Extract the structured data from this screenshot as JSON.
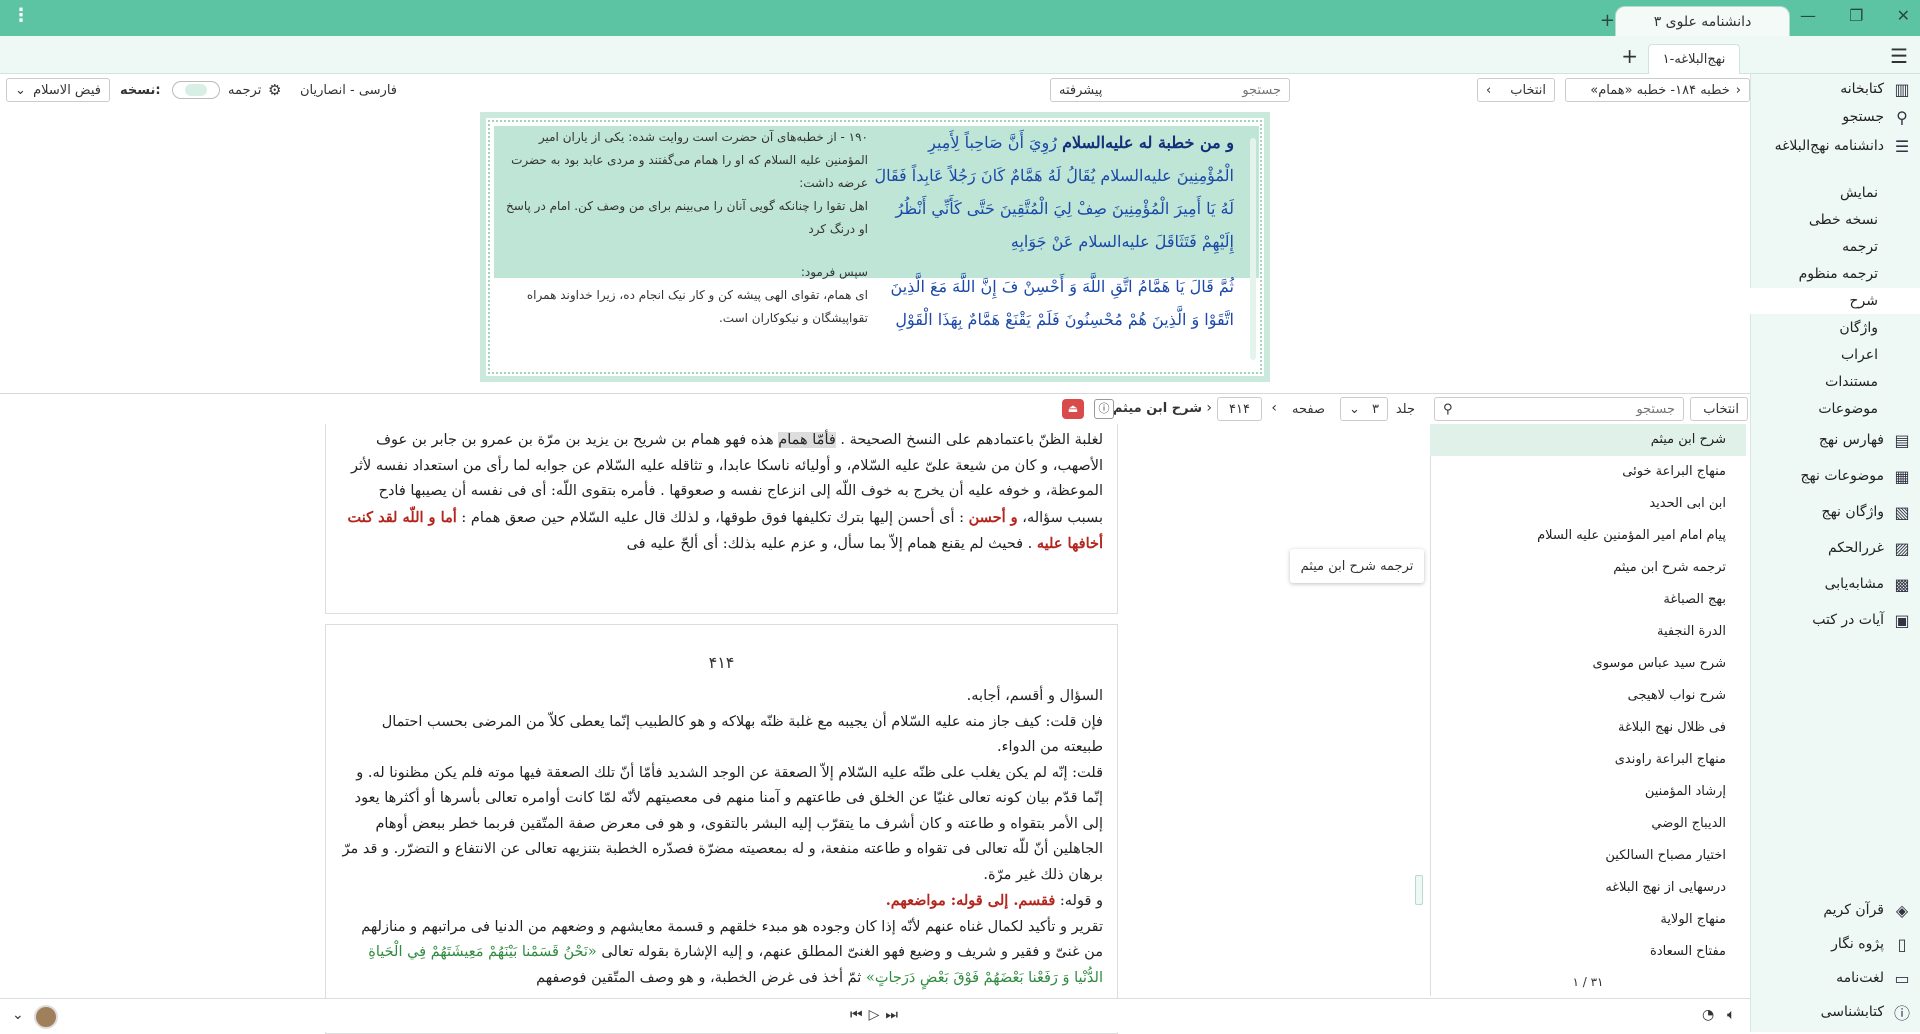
{
  "titlebar": {
    "app_tab": "دانشنامه علوی ۳",
    "menu_icon": "kebab-icon"
  },
  "tabbar": {
    "doc_tab": "نهج‌البلاغه-۱"
  },
  "sidebar": {
    "top_items": [
      {
        "label": "کتابخانه",
        "icon": "library-icon"
      },
      {
        "label": "جستجو",
        "icon": "search-icon"
      },
      {
        "label": "دانشنامه نهج‌البلاغه",
        "icon": "encyclopedia-icon"
      }
    ],
    "sub_items": [
      "نمایش",
      "نسخه خطی",
      "ترجمه",
      "ترجمه منظوم",
      "شرح",
      "واژگان",
      "اعراب",
      "مستندات",
      "موضوعات"
    ],
    "active_sub": "شرح",
    "mid_items": [
      {
        "label": "فهارس نهج",
        "icon": "index-icon"
      },
      {
        "label": "موضوعات نهج",
        "icon": "topics-icon"
      },
      {
        "label": "واژگان نهج",
        "icon": "words-icon"
      },
      {
        "label": "غررالحکم",
        "icon": "book-icon"
      },
      {
        "label": "مشابه‌یابی",
        "icon": "similar-icon"
      },
      {
        "label": "آیات در کتب",
        "icon": "verses-icon"
      }
    ],
    "bottom_items": [
      {
        "label": "قرآن کریم",
        "icon": "quran-icon"
      },
      {
        "label": "پژوه نگار",
        "icon": "notes-icon"
      },
      {
        "label": "لغت‌نامه",
        "icon": "dictionary-icon"
      },
      {
        "label": "کتابشناسی",
        "icon": "info-icon"
      }
    ]
  },
  "toolbar": {
    "breadcrumb": "خطبه ۱۸۴- خطبه «همام»",
    "select_label": "انتخاب",
    "search_placeholder": "جستجو",
    "advanced": "پیشرفته",
    "translation_lang": "فارسی - انصاریان",
    "translation_label": "ترجمه",
    "version_label": "نسخه:",
    "version_value": "فیض الاسلام"
  },
  "toppanel": {
    "ar_bold": "و من خطبة له عليه‌السلام",
    "ar_text": " رُوِيَ أَنَّ صَاحِباً لِأَمِيرِ الْمُؤْمِنِينَ عليه‌السلام يُقَالُ لَهُ هَمَّامٌ كَانَ رَجُلاً عَابِداً فَقَالَ لَهُ يَا أَمِيرَ الْمُؤْمِنِينَ صِفْ لِيَ الْمُتَّقِينَ حَتَّى كَأَنِّي أَنْظُرُ إِلَيْهِمْ فَتَثَاقَلَ عليه‌السلام عَنْ جَوَابِهِ",
    "ar_text2": "ثُمَّ قَالَ يَا هَمَّامُ اتَّقِ اللَّهَ وَ أَحْسِنْ فَ إِنَّ اللَّهَ مَعَ الَّذِينَ اتَّقَوْا وَ الَّذِينَ هُمْ مُحْسِنُونَ فَلَمْ يَقْنَعْ هَمَّامٌ بِهَذَا الْقَوْلِ",
    "fa_text": "۱۹۰ - از خطبه‌های آن حضرت است روایت شده: یکی از یاران امیر المؤمنین علیه السلام که او را همام می‌گفتند و مردی عابد بود به حضرت عرضه داشت:",
    "fa_text_b": "اهل تقوا را چنانکه گویی آنان را می‌بینم برای من وصف کن. امام در پاسخ او درنگ کرد",
    "fa_text2a": "سپس فرمود:",
    "fa_text2b": "ای همام، تقوای الهی پیشه کن و کار نیک انجام ده، زیرا خداوند همراه تقواپیشگان و نیکوکاران است."
  },
  "lowerbar": {
    "select_label": "انتخاب",
    "search_placeholder": "جستجو",
    "volume_label": "جلد",
    "volume_value": "۳",
    "page_label": "صفحه",
    "page_value": "۴۱۴",
    "commentary": "شرح ابن میثم"
  },
  "commentaries": [
    "شرح ابن میثم",
    "منهاج البراعة خوئی",
    "ابن ابی الحدید",
    "پیام امام امیر المؤمنین علیه السلام",
    "ترجمه شرح ابن میثم",
    "بهج الصباغة",
    "الدرة النجفية",
    "شرح سید عباس موسوی",
    "شرح نواب لاهیجی",
    "فی ظلال نهج البلاغة",
    "منهاج البراعة راوندی",
    "إرشاد المؤمنين",
    "الديباج الوضي",
    "اختيار مصباح السالكين",
    "درسهایی از نهج البلاغه",
    "منهاج الولاية",
    "مفتاح السعادة"
  ],
  "commentary_pager": "۱ / ۳۱",
  "tooltip": "ترجمه شرح ابن میثم",
  "pageA": {
    "line1_a": "لغلبة الظنّ باعتمادهم على النسخ الصحيحة . ",
    "line1_hl": "فأمّا همام",
    "line1_b": " هذه فهو همام بن شريح بن يزيد بن مرّة بن عمرو بن جابر بن عوف الأصهب، و كان من شيعة علىّ عليه السّلام، و أوليائه ناسكا عابدا، و تثاقله عليه السّلام عن جوابه لما رأى من استعداد نفسه لأثر الموعظة، و خوفه عليه أن يخرج به خوف اللّه إلى انزعاج نفسه و صعوقها . فأمره بتقوى اللّه: أى فى نفسه أن يصيبها فادح بسبب سؤاله، ",
    "red1": "و أحسن",
    "mid1": " : أى أحسن إليها بترك تكليفها فوق طوقها، و لذلك قال عليه السّلام حين صعق همام : ",
    "red2": "أما و اللّه لقد كنت أخافها عليه",
    "tail": " . فحيث لم يقنع همام إلاّ بما سأل، و عزم عليه بذلك: أى ألحّ عليه فى"
  },
  "pageB": {
    "page_number": "۴۱۴",
    "p1": "السؤال و أقسم، أجابه.",
    "p2": "فإن قلت: كيف جاز منه عليه السّلام أن يجيبه مع غلبة ظنّه بهلاكه و هو كالطبيب إنّما يعطى كلاّ من المرضى بحسب احتمال طبيعته من الدواء.",
    "p3": "قلت: إنّه لم يكن يغلب على ظنّه عليه السّلام إلاّ الصعقة عن الوجد الشديد فأمّا أنّ تلك الصعقة فيها موته فلم يكن مظنونا له. و إنّما قدّم بيان كونه تعالى غنيّا عن الخلق فى طاعتهم و آمنا منهم فى معصيتهم لأنّه لمّا كانت أوامره تعالى بأسرها أو أكثرها يعود إلى الأمر بتقواه و طاعته و كان أشرف ما يتقرّب إليه البشر بالتقوى، و هو فى معرض صفة المتّقين فربما خطر ببعض أوهام الجاهلين أنّ للّه تعالى فى تقواه و طاعته منفعة، و له بمعصيته مضرّة فصدّره الخطبة بتنزيهه تعالى عن الانتفاع و التضرّر. و قد مرّ برهان ذلك غير مرّة.",
    "p4a": "و قوله: ",
    "p4red": "فقسم. إلى قوله: مواضعهم.",
    "p5a": "تقرير و تأكيد لكمال غناه عنهم لأنّه إذا كان وجوده هو مبدء خلقهم و قسمة معايشهم و وضعهم من الدنيا فى مراتبهم و منازلهم من غنىّ و فقير و شريف و وضيع فهو الغنىّ المطلق عنهم، و إليه الإشارة بقوله تعالى ",
    "p5green": "«نَحْنُ قَسَمْنا بَيْنَهُمْ مَعِيشَتَهُمْ فِي الْحَياةِ الدُّنْيا وَ رَفَعْنا بَعْضَهُمْ فَوْقَ بَعْضٍ دَرَجاتٍ»",
    "p5b": " ثمّ أخذ فى غرض الخطبة، و هو وصف المتّقين فوصفهم"
  },
  "colors": {
    "accent": "#5cc4a3",
    "panel_bg": "#eef8f4",
    "arabic_blue": "#1b49a8",
    "red": "#b3261e",
    "green": "#2e8a3e"
  }
}
